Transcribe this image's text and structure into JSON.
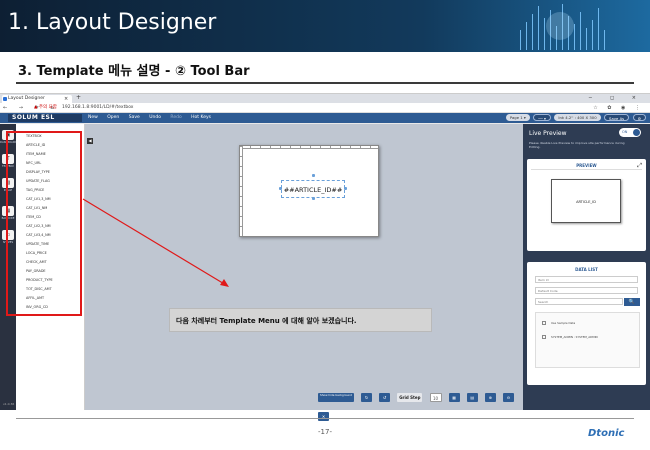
{
  "slide": {
    "title": "1. Layout Designer",
    "subtitle": "3.  Template 메뉴 설명 - ② Tool Bar",
    "page_number": "-17-",
    "brand": "Dtonic"
  },
  "browser": {
    "tab_title": "Layout Designer",
    "tab_close": "×",
    "new_tab": "+",
    "window_controls": "−  ◻  ×",
    "nav": "← → ⟳ ⌂",
    "security_warning": "▲ 주의 요함",
    "url": "192.168.1.8:9001/LD/#/textbox",
    "toolbar_icons": "☆ ✿ ◉ ⋮"
  },
  "app": {
    "logo": "SOLUM ESL",
    "menu": [
      "New",
      "Open",
      "Save",
      "Undo",
      "Redo",
      "Hot Keys"
    ],
    "header_controls": {
      "page_select": "Page 1 ▾",
      "zoom_select": "── ▾",
      "size_select": "Ink 4.2'' : 400 X 300",
      "save_as": "Save As",
      "settings_icon": "⚙"
    },
    "rail": [
      {
        "icon": "▣",
        "label": "DASHBOARD"
      },
      {
        "icon": "T",
        "label": "TEXTBOX"
      },
      {
        "icon": "▧",
        "label": "IMAGE"
      },
      {
        "icon": "▦",
        "label": "BARCODE"
      },
      {
        "icon": "▭",
        "label": "SHAPES"
      }
    ],
    "version": "v1.0.36",
    "fields": [
      "TEXTBOX",
      "ARTICLE_ID",
      "ITEM_NAME",
      "NFC_URL",
      "DISPLAY_TYPE",
      "UPDATE_FLAG",
      "TAG_PRICE",
      "CAT_LV1,3_NM",
      "CAT_LV1_NM",
      "ITEM_CD",
      "CAT_LV2,3_NM",
      "CAT_LV3,4_NM",
      "UPDATE_TIME",
      "LOCA_PRICE",
      "CHECK_AMT",
      "PAY_GRADE",
      "PRODUCT_TYPE",
      "TOT_DISC_AMT",
      "AFFIL_AMT",
      "INV_ORG_CD"
    ],
    "canvas_text": "##ARTICLE_ID##",
    "collapse_icon": "◀",
    "instruction": "다음 차례부터 Template Menu 에 대해 알아 보겠습니다.",
    "bottom_toolbar": {
      "wide_label": "Show hide background",
      "redo": "↻",
      "undo": "↺",
      "grid_label": "Grid Step",
      "grid_value": "10",
      "buttons": [
        "▦",
        "▤",
        "⊕",
        "⊖",
        "✕"
      ]
    },
    "live_preview": {
      "title": "Live Preview",
      "toggle": "ON",
      "note": "Please disable Live Preview to improve site performance during Editing.",
      "preview_title": "PREVIEW",
      "expand_icon": "⤢",
      "preview_text": "ARTICLE_ID"
    },
    "data_list": {
      "title": "DATA LIST",
      "select": "Item Id",
      "input_placeholder": "Default Code",
      "search_placeholder": "Search",
      "search_icon": "🔍",
      "rows": [
        "Use Sample Data",
        "SYSTEM_ADMIN : SYSTEM_ADMIN"
      ]
    }
  },
  "colors": {
    "accent": "#2e5b93",
    "highlight": "#e01919"
  }
}
